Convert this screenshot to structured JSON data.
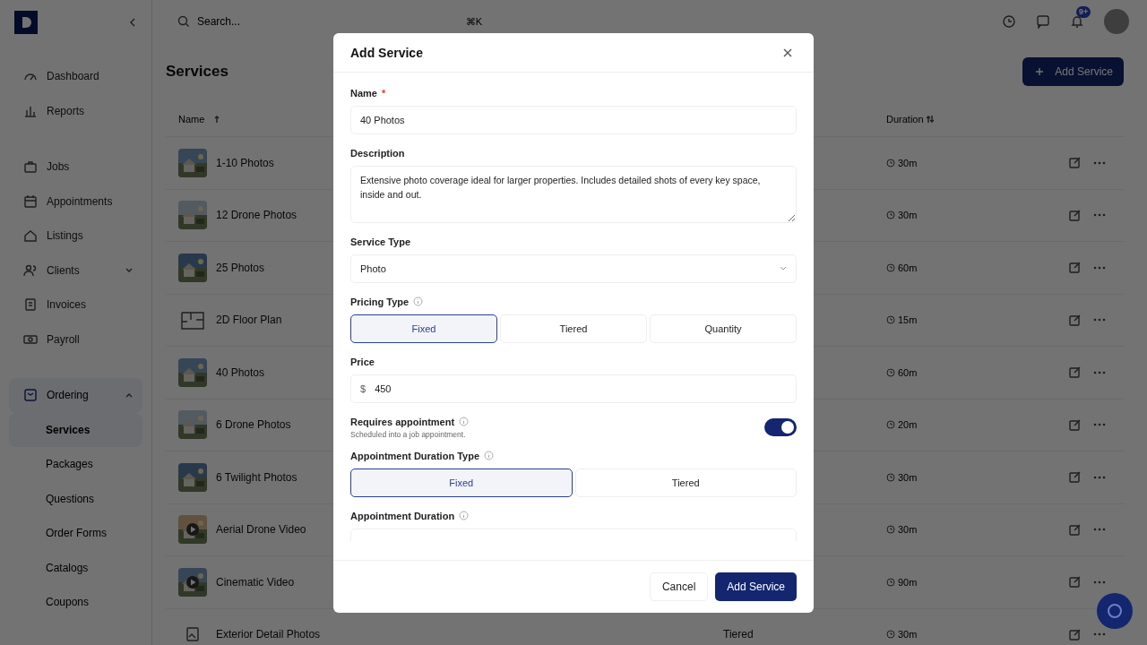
{
  "sidebar": {
    "items": [
      {
        "label": "Dashboard",
        "selected": false
      },
      {
        "label": "Reports",
        "selected": false
      },
      {
        "label": "Jobs",
        "selected": false
      },
      {
        "label": "Appointments",
        "selected": false
      },
      {
        "label": "Listings",
        "selected": false
      },
      {
        "label": "Clients",
        "selected": false,
        "expanded": false
      },
      {
        "label": "Invoices",
        "selected": false
      },
      {
        "label": "Payroll",
        "selected": false
      },
      {
        "label": "Ordering",
        "selected": true,
        "expanded": true,
        "children": [
          {
            "label": "Services",
            "selected": true
          },
          {
            "label": "Packages",
            "selected": false
          },
          {
            "label": "Questions",
            "selected": false
          },
          {
            "label": "Order Forms",
            "selected": false
          },
          {
            "label": "Catalogs",
            "selected": false
          },
          {
            "label": "Coupons",
            "selected": false
          }
        ]
      }
    ]
  },
  "topbar": {
    "search": {
      "placeholder": "Search...",
      "shortcut": "⌘K"
    },
    "notifications_badge": "9+"
  },
  "page": {
    "title": "Services",
    "add_button": "Add Service"
  },
  "table": {
    "columns": [
      {
        "label": "Name"
      },
      {
        "label": "Duration"
      }
    ],
    "rows": [
      {
        "name": "1-10 Photos",
        "duration": "30m",
        "kind": "picture"
      },
      {
        "name": "12 Drone Photos",
        "duration": "30m",
        "kind": "picture"
      },
      {
        "name": "25 Photos",
        "duration": "60m",
        "kind": "picture"
      },
      {
        "name": "2D Floor Plan",
        "duration": "15m",
        "kind": "plan"
      },
      {
        "name": "40 Photos",
        "duration": "60m",
        "kind": "picture"
      },
      {
        "name": "6 Drone Photos",
        "duration": "20m",
        "kind": "picture"
      },
      {
        "name": "6 Twilight Photos",
        "duration": "30m",
        "kind": "picture"
      },
      {
        "name": "Aerial Drone Video",
        "duration": "30m",
        "kind": "video"
      },
      {
        "name": "Cinematic Video",
        "duration": "90m",
        "kind": "video"
      },
      {
        "name": "Exterior Detail Photos",
        "duration": "30m",
        "kind": "icon",
        "column_3": "Tiered"
      }
    ]
  },
  "modal": {
    "title": "Add Service",
    "fields": [
      {
        "kind": "text",
        "label": "Name",
        "required_mark": "*",
        "value": "40 Photos"
      },
      {
        "kind": "textarea",
        "label": "Description",
        "value": "Extensive photo coverage ideal for larger properties. Includes detailed shots of every key space, inside and out."
      },
      {
        "kind": "select",
        "label": "Service Type",
        "value": "Photo"
      },
      {
        "kind": "segmented",
        "label": "Pricing Type",
        "info": true,
        "options": [
          {
            "label": "Fixed",
            "selected": true
          },
          {
            "label": "Tiered",
            "selected": false
          },
          {
            "label": "Quantity",
            "selected": false
          }
        ]
      },
      {
        "kind": "price",
        "label": "Price",
        "prefix": "$",
        "value": "450"
      },
      {
        "kind": "toggle",
        "label": "Requires appointment",
        "info": true,
        "hint": "Scheduled into a job appointment.",
        "on": true
      },
      {
        "kind": "segmented",
        "label": "Appointment Duration Type",
        "info": true,
        "options": [
          {
            "label": "Fixed",
            "selected": true
          },
          {
            "label": "Tiered",
            "selected": false
          }
        ]
      },
      {
        "kind": "select",
        "label": "Appointment Duration",
        "info": true
      }
    ],
    "buttons": [
      {
        "label": "Cancel",
        "kind": "secondary"
      },
      {
        "label": "Add Service",
        "kind": "primary"
      }
    ]
  }
}
